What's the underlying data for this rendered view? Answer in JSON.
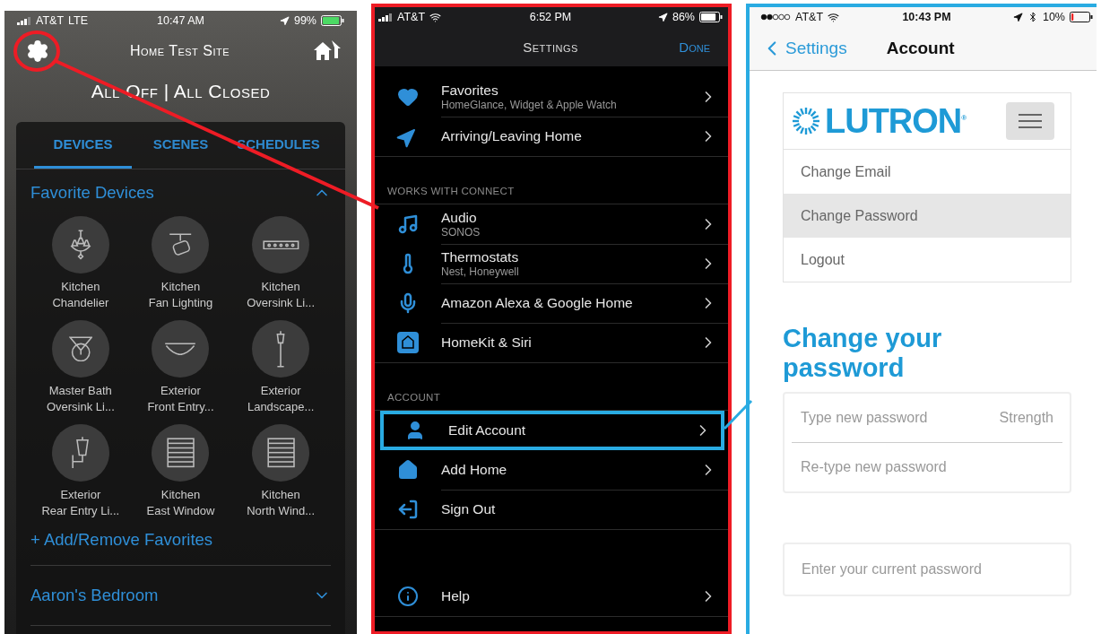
{
  "home_screen": {
    "status_bar": {
      "carrier": "AT&T",
      "network": "LTE",
      "time": "10:47 AM",
      "battery": "99%"
    },
    "title": "Home Test Site",
    "summary": "All Off | All Closed",
    "tabs": [
      {
        "label": "DEVICES",
        "selected": true
      },
      {
        "label": "SCENES",
        "selected": false
      },
      {
        "label": "SCHEDULES",
        "selected": false
      }
    ],
    "favorites": {
      "title": "Favorite Devices",
      "expanded": true,
      "devices": [
        {
          "kind": "chandelier",
          "line1": "Kitchen",
          "line2": "Chandelier"
        },
        {
          "kind": "track",
          "line1": "Kitchen",
          "line2": "Fan Lighting"
        },
        {
          "kind": "linear",
          "line1": "Kitchen",
          "line2": "Oversink Li..."
        },
        {
          "kind": "pendant",
          "line1": "Master Bath",
          "line2": "Oversink Li..."
        },
        {
          "kind": "ceiling",
          "line1": "Exterior",
          "line2": "Front Entry..."
        },
        {
          "kind": "post",
          "line1": "Exterior",
          "line2": "Landscape..."
        },
        {
          "kind": "wall-lantern",
          "line1": "Exterior",
          "line2": "Rear Entry Li..."
        },
        {
          "kind": "shade",
          "line1": "Kitchen",
          "line2": "East Window"
        },
        {
          "kind": "shade",
          "line1": "Kitchen",
          "line2": "North Wind..."
        }
      ],
      "add_link": "+ Add/Remove Favorites"
    },
    "rooms": [
      {
        "name": "Aaron's Bedroom",
        "expanded": false
      }
    ]
  },
  "settings_screen": {
    "status_bar": {
      "carrier": "AT&T",
      "time": "6:52 PM",
      "battery": "86%"
    },
    "title": "Settings",
    "done": "Done",
    "groups": [
      {
        "items": [
          {
            "kind": "heart",
            "title": "Favorites",
            "subtitle": "HomeGlance, Widget & Apple Watch",
            "chevron": true,
            "highlighted": false
          },
          {
            "kind": "arrow",
            "title": "Arriving/Leaving Home",
            "chevron": true,
            "highlighted": false
          }
        ]
      },
      {
        "header": "WORKS WITH CONNECT",
        "items": [
          {
            "kind": "note",
            "title": "Audio",
            "subtitle": "SONOS",
            "chevron": true,
            "highlighted": false
          },
          {
            "kind": "thermometer",
            "title": "Thermostats",
            "subtitle": "Nest, Honeywell",
            "chevron": true,
            "highlighted": false
          },
          {
            "kind": "mic",
            "title": "Amazon Alexa & Google Home",
            "chevron": true,
            "highlighted": false
          },
          {
            "kind": "homekit",
            "title": "HomeKit & Siri",
            "chevron": true,
            "highlighted": false
          }
        ]
      },
      {
        "header": "ACCOUNT",
        "items": [
          {
            "kind": "person",
            "title": "Edit Account",
            "chevron": true,
            "highlighted": true
          },
          {
            "kind": "house",
            "title": "Add Home",
            "chevron": true,
            "highlighted": false
          },
          {
            "kind": "signout",
            "title": "Sign Out",
            "chevron": false,
            "highlighted": false
          }
        ]
      },
      {
        "items": [
          {
            "kind": "info",
            "title": "Help",
            "chevron": true,
            "highlighted": false
          }
        ]
      }
    ]
  },
  "account_screen": {
    "status_bar": {
      "carrier": "AT&T",
      "time": "10:43 PM",
      "battery": "10%"
    },
    "back": "Settings",
    "title": "Account",
    "logo": "LUTRON$^{®}$",
    "menu": [
      {
        "label": "Change Email",
        "selected": false
      },
      {
        "label": "Change Password",
        "selected": true
      },
      {
        "label": "Logout",
        "selected": false
      }
    ],
    "heading": "Change your password",
    "new_password": {
      "placeholder": "Type new password",
      "strength_label": "Strength"
    },
    "retype_password": {
      "placeholder": "Re-type new password"
    },
    "current_password": {
      "placeholder": "Enter your current password"
    }
  }
}
